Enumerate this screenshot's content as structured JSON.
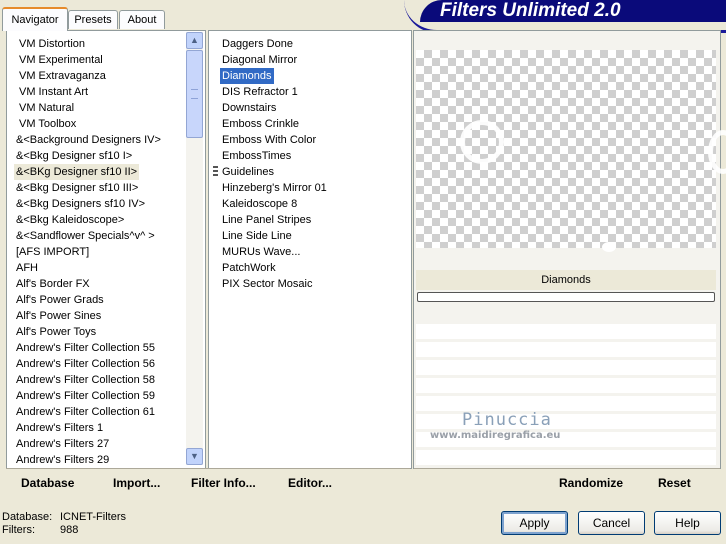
{
  "tabs": [
    {
      "label": "Navigator",
      "active": true
    },
    {
      "label": "Presets",
      "active": false
    },
    {
      "label": "About",
      "active": false
    }
  ],
  "banner_title": "Filters Unlimited 2.0",
  "categories": [
    "VM Distortion",
    "VM Experimental",
    "VM Extravaganza",
    "VM Instant Art",
    "VM Natural",
    "VM Toolbox",
    "&<Background Designers IV>",
    "&<Bkg Designer sf10 I>",
    "&<BKg Designer sf10 II>",
    "&<Bkg Designer sf10 III>",
    "&<Bkg Designers sf10 IV>",
    "&<Bkg Kaleidoscope>",
    "&<Sandflower Specials^v^ >",
    "[AFS IMPORT]",
    "AFH",
    "Alf's Border FX",
    "Alf's Power Grads",
    "Alf's Power Sines",
    "Alf's Power Toys",
    "Andrew's Filter Collection 55",
    "Andrew's Filter Collection 56",
    "Andrew's Filter Collection 58",
    "Andrew's Filter Collection 59",
    "Andrew's Filter Collection 61",
    "Andrew's Filters 1",
    "Andrew's Filters 27",
    "Andrew's Filters 29"
  ],
  "filters": [
    "Daggers Done",
    "Diagonal Mirror",
    "Diamonds",
    "DIS Refractor 1",
    "Downstairs",
    "Emboss Crinkle",
    "Emboss With Color",
    "EmbossTimes",
    "Guidelines",
    "Hinzeberg's Mirror 01",
    "Kaleidoscope 8",
    "Line Panel Stripes",
    "Line Side Line",
    "MURUs Wave...",
    "PatchWork",
    "PIX Sector Mosaic"
  ],
  "selected_category_index": 8,
  "selected_filter_index": 2,
  "preview_label": "Diamonds",
  "watermark": {
    "name": "Pinuccia",
    "url": "www.maidiregrafica.eu"
  },
  "toolbar": {
    "database": "Database",
    "import": "Import...",
    "filter_info": "Filter Info...",
    "editor": "Editor...",
    "randomize": "Randomize",
    "reset": "Reset"
  },
  "status": {
    "database_label": "Database:",
    "database_value": "ICNET-Filters",
    "filters_label": "Filters:",
    "filters_value": "988"
  },
  "buttons": {
    "apply": "Apply",
    "cancel": "Cancel",
    "help": "Help"
  }
}
